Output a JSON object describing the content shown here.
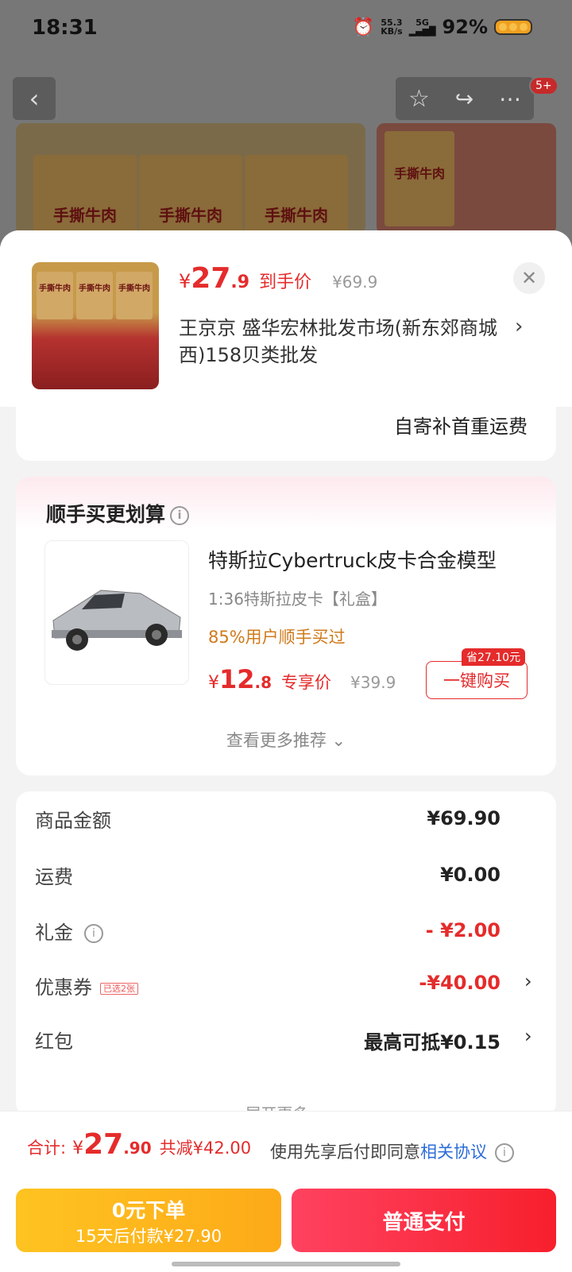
{
  "status_bar": {
    "time": "18:31",
    "speed_top": "55.3",
    "speed_bottom": "KB/s",
    "signal": "5G",
    "battery": "92%"
  },
  "top_nav": {
    "badge": "5+"
  },
  "packaging_text": "手撕牛肉",
  "sheet": {
    "price_currency": "¥",
    "price_int": "27",
    "price_dec": ".9",
    "price_tag": "到手价",
    "orig_price": "¥69.9",
    "address": "王京京  盛华宏林批发市场(新东郊商城西)158贝类批发",
    "shipping_note": "自寄补首重运费"
  },
  "upsell": {
    "title": "顺手买更划算",
    "product_name": "特斯拉Cybertruck皮卡合金模型",
    "spec": "1:36特斯拉皮卡【礼盒】",
    "percent": "85%用户顺手买过",
    "price_currency": "¥",
    "price_int": "12",
    "price_dec": ".8",
    "price_tag": "专享价",
    "orig_price": "¥39.9",
    "save_badge": "省27.10元",
    "buy_label": "一键购买",
    "more_label": "查看更多推荐 ⌄"
  },
  "summary": {
    "rows": [
      {
        "label": "商品金额",
        "value": "¥69.90"
      },
      {
        "label": "运费",
        "value": "¥0.00"
      },
      {
        "label": "礼金",
        "value": "- ¥2.00"
      },
      {
        "label": "优惠券",
        "value": "-¥40.00",
        "badge": "已选2张"
      },
      {
        "label": "红包",
        "value": "最高可抵¥0.15"
      }
    ],
    "expand_label": "展开更多 ⌄"
  },
  "bottom": {
    "total_label": "合计:",
    "total_currency": "¥",
    "total_int": "27",
    "total_dec": ".90",
    "total_minus": "共减¥42.00",
    "agree_text": "使用先享后付即同意",
    "agree_link": "相关协议",
    "later_line1": "0元下单",
    "later_line2": "15天后付款¥27.90",
    "pay_label": "普通支付"
  }
}
